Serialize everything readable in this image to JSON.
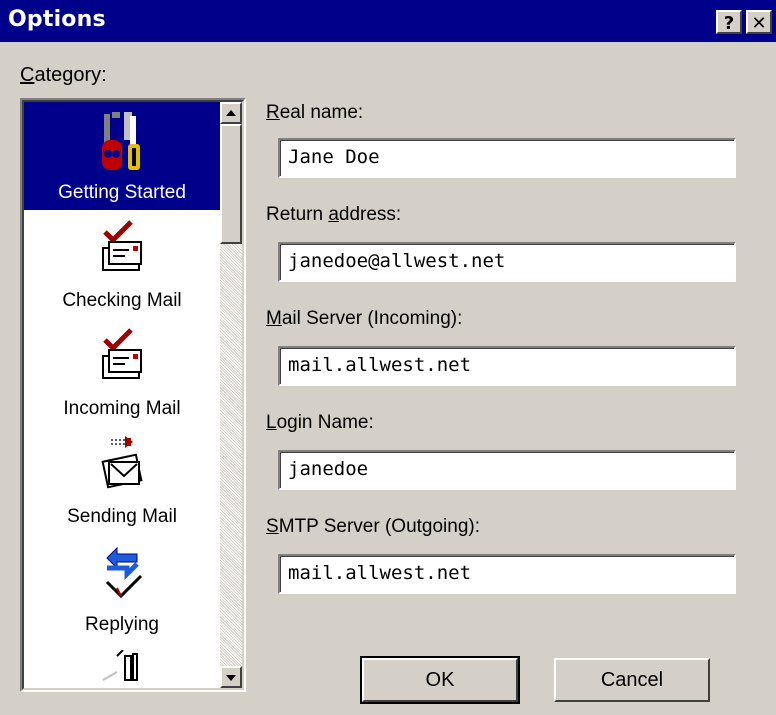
{
  "window": {
    "title": "Options",
    "help_button": "?",
    "close_button": "✕"
  },
  "category": {
    "label_mnemonic": "C",
    "label_rest": "ategory:",
    "items": [
      {
        "label": "Getting Started",
        "icon": "tools-icon",
        "selected": true
      },
      {
        "label": "Checking Mail",
        "icon": "check-mail-icon",
        "selected": false
      },
      {
        "label": "Incoming Mail",
        "icon": "incoming-mail-icon",
        "selected": false
      },
      {
        "label": "Sending Mail",
        "icon": "sending-mail-icon",
        "selected": false
      },
      {
        "label": "Replying",
        "icon": "replying-icon",
        "selected": false
      }
    ]
  },
  "form": {
    "real_name": {
      "mnemonic": "R",
      "rest": "eal name:",
      "value": "Jane Doe"
    },
    "return_address": {
      "pre": "Return ",
      "mnemonic": "a",
      "rest": "ddress:",
      "value": "janedoe@allwest.net"
    },
    "mail_server": {
      "mnemonic": "M",
      "rest": "ail Server (Incoming):",
      "value": "mail.allwest.net"
    },
    "login_name": {
      "mnemonic": "L",
      "rest": "ogin Name:",
      "value": "janedoe"
    },
    "smtp_server": {
      "mnemonic": "S",
      "rest": "MTP Server (Outgoing):",
      "value": "mail.allwest.net"
    }
  },
  "buttons": {
    "ok": "OK",
    "cancel": "Cancel"
  },
  "colors": {
    "titlebar": "#00008b",
    "face": "#d4d0c8",
    "selection": "#00008b"
  }
}
